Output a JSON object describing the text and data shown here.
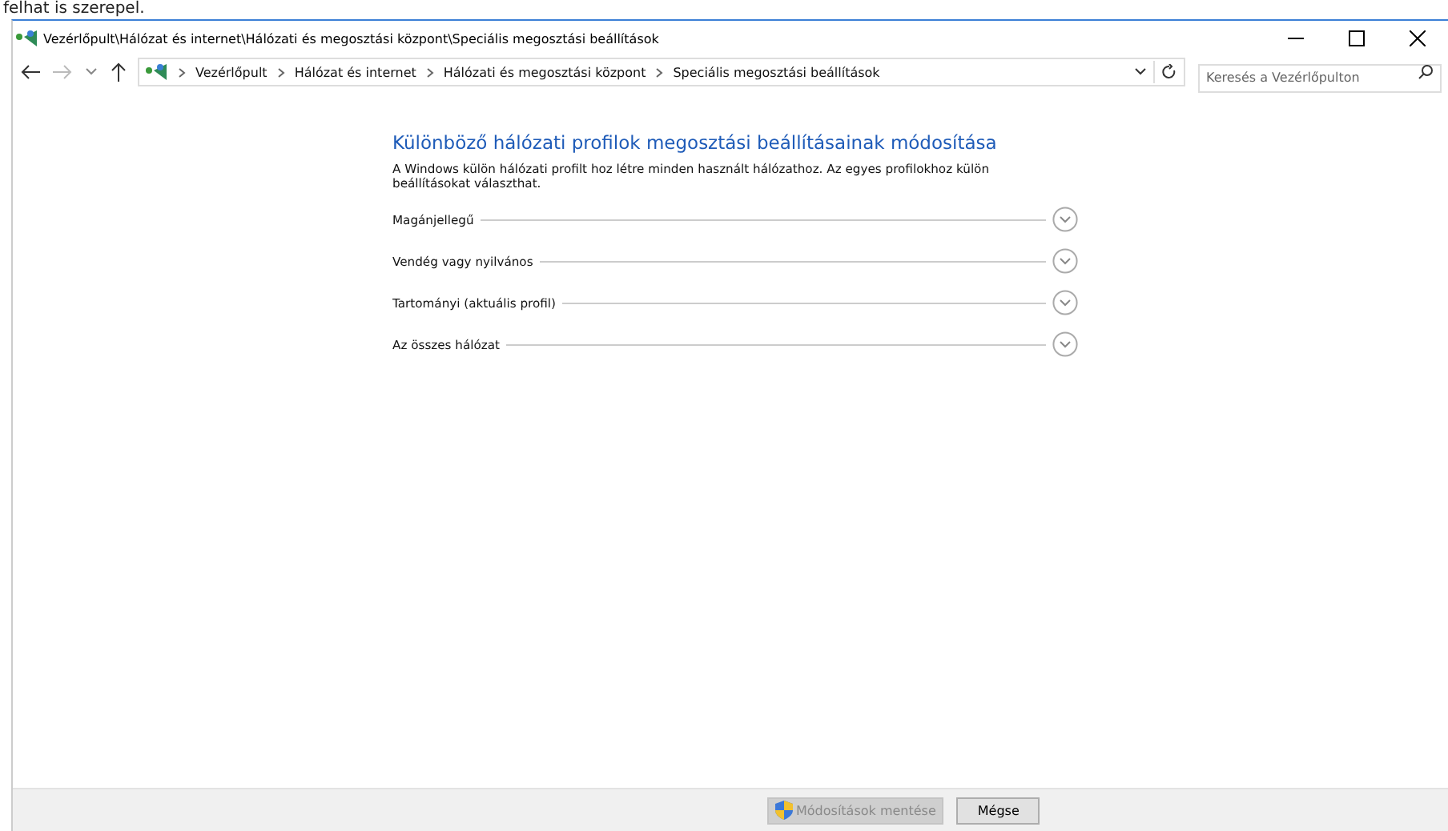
{
  "background_caption": "felhat is szerepel.",
  "window": {
    "title": "Vezérlőpult\\Hálózat és internet\\Hálózati és megosztási központ\\Speciális megosztási beállítások"
  },
  "address_bar": {
    "breadcrumbs": [
      "Vezérlőpult",
      "Hálózat és internet",
      "Hálózati és megosztási központ",
      "Speciális megosztási beállítások"
    ],
    "search": {
      "placeholder": "Keresés a Vezérlőpulton"
    }
  },
  "content": {
    "heading": "Különböző hálózati profilok megosztási beállításainak módosítása",
    "description": "A Windows külön hálózati profilt hoz létre minden használt hálózathoz. Az egyes profilokhoz külön beállításokat választhat.",
    "sections": [
      {
        "label": "Magánjellegű",
        "expanded": false
      },
      {
        "label": "Vendég vagy nyilvános",
        "expanded": false
      },
      {
        "label": "Tartományi (aktuális profil)",
        "expanded": false
      },
      {
        "label": "Az összes hálózat",
        "expanded": false
      }
    ]
  },
  "footer": {
    "buttons": [
      {
        "label": "Módosítások mentése",
        "disabled": true,
        "kind": "shield"
      },
      {
        "label": "Mégse",
        "disabled": false,
        "kind": "plain"
      }
    ]
  }
}
